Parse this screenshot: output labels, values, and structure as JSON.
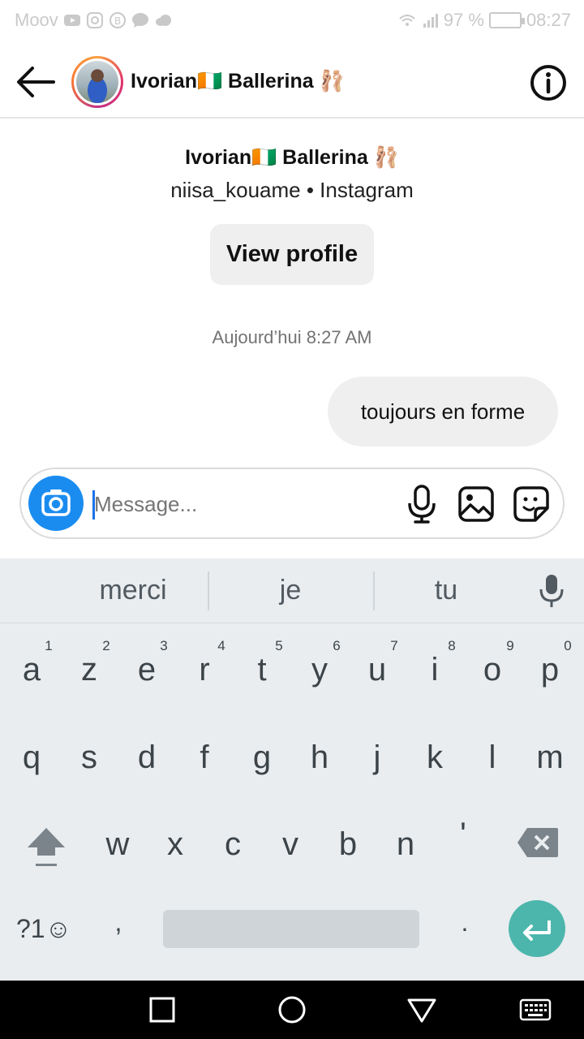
{
  "status_bar": {
    "carrier": "Moov",
    "battery_percent": "97 %",
    "time": "08:27"
  },
  "header": {
    "title": "Ivorian🇨🇮 Ballerina 🩰"
  },
  "profile": {
    "name": "Ivorian🇨🇮 Ballerina 🩰",
    "subtitle": "niisa_kouame • Instagram",
    "view_profile_label": "View profile"
  },
  "thread": {
    "timestamp": "Aujourd’hui 8:27 AM",
    "messages": [
      {
        "text": "toujours en forme",
        "from": "me"
      }
    ]
  },
  "composer": {
    "placeholder": "Message..."
  },
  "keyboard": {
    "suggestions": [
      "merci",
      "je",
      "tu"
    ],
    "row1": [
      "a",
      "z",
      "e",
      "r",
      "t",
      "y",
      "u",
      "i",
      "o",
      "p"
    ],
    "row1_hints": [
      "1",
      "2",
      "3",
      "4",
      "5",
      "6",
      "7",
      "8",
      "9",
      "0"
    ],
    "row2": [
      "q",
      "s",
      "d",
      "f",
      "g",
      "h",
      "j",
      "k",
      "l",
      "m"
    ],
    "row3": [
      "w",
      "x",
      "c",
      "v",
      "b",
      "n",
      "'"
    ],
    "symbols_label": "?1☺",
    "comma": ",",
    "period": ".",
    "accent_color": "#4db6ac"
  },
  "colors": {
    "camera_button": "#1a8cf0",
    "bubble": "#efefef"
  }
}
